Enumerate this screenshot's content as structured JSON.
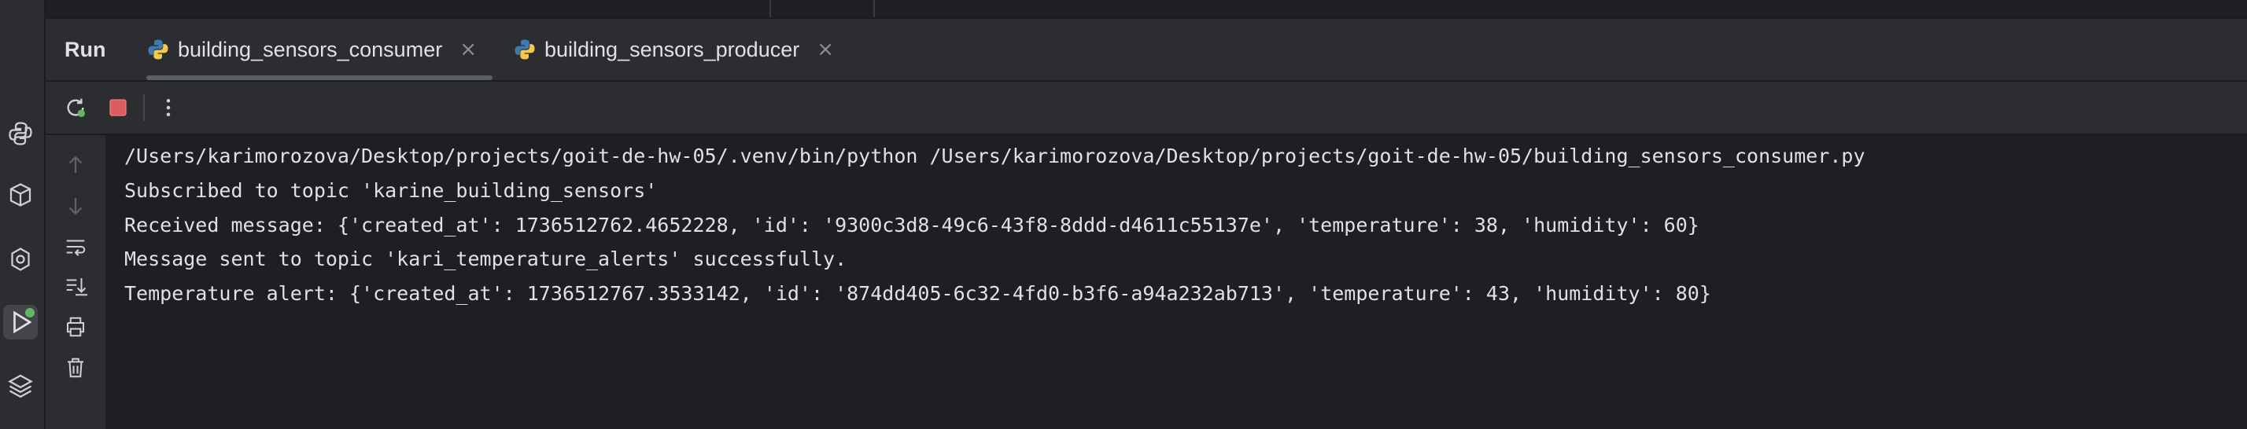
{
  "run_panel": {
    "title": "Run"
  },
  "tabs": [
    {
      "label": "building_sensors_consumer",
      "active": true
    },
    {
      "label": "building_sensors_producer",
      "active": false
    }
  ],
  "tab_close_glyph": "×",
  "toolbar": {
    "icons": [
      "rerun-icon",
      "stop-icon",
      "more-options-icon"
    ]
  },
  "gutter": {
    "icons": [
      "scroll-up-icon",
      "scroll-down-icon",
      "soft-wrap-icon",
      "scroll-to-end-icon",
      "print-icon",
      "clear-all-icon"
    ]
  },
  "left_bar": {
    "icons": [
      "python-console-icon",
      "python-packages-icon",
      "services-icon",
      "run-icon",
      "layers-icon"
    ]
  },
  "console": {
    "lines": [
      "/Users/karimorozova/Desktop/projects/goit-de-hw-05/.venv/bin/python /Users/karimorozova/Desktop/projects/goit-de-hw-05/building_sensors_consumer.py",
      "Subscribed to topic 'karine_building_sensors'",
      "Received message: {'created_at': 1736512762.4652228, 'id': '9300c3d8-49c6-43f8-8ddd-d4611c55137e', 'temperature': 38, 'humidity': 60}",
      "Message sent to topic 'kari_temperature_alerts' successfully.",
      "Temperature alert: {'created_at': 1736512767.3533142, 'id': '874dd405-6c32-4fd0-b3f6-a94a232ab713', 'temperature': 43, 'humidity': 80}"
    ]
  },
  "colors": {
    "background": "#1e1f22",
    "panel": "#2b2d30",
    "text": "#dfe1e5",
    "stop_red": "#db5c5c",
    "rerun_green": "#5fb865",
    "python_blue": "#3d7ab4",
    "python_yellow": "#f2c94c"
  }
}
